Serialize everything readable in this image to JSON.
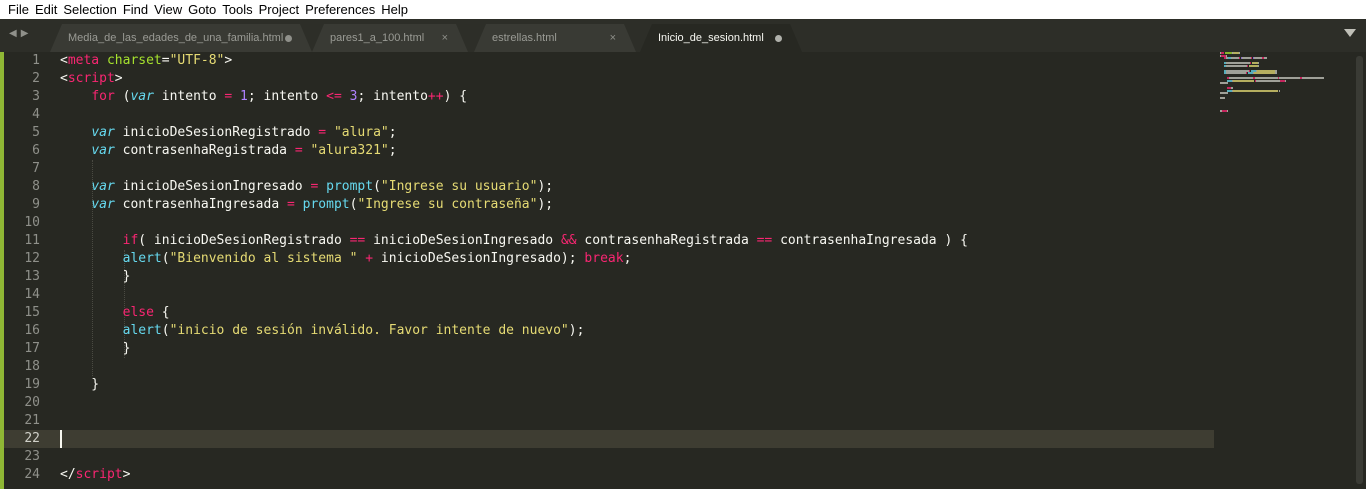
{
  "menu": [
    "File",
    "Edit",
    "Selection",
    "Find",
    "View",
    "Goto",
    "Tools",
    "Project",
    "Preferences",
    "Help"
  ],
  "tabs": [
    {
      "title": "Media_de_las_edades_de_una_familia.html",
      "indicator": "dot",
      "active": false
    },
    {
      "title": "pares1_a_100.html",
      "indicator": "close",
      "close_glyph": "×",
      "active": false
    },
    {
      "title": "estrellas.html",
      "indicator": "close",
      "close_glyph": "×",
      "active": false
    },
    {
      "title": "Inicio_de_sesion.html",
      "indicator": "dot",
      "active": true
    }
  ],
  "editor": {
    "current_line": 22,
    "line_numbers": [
      "1",
      "2",
      "3",
      "4",
      "5",
      "6",
      "7",
      "8",
      "9",
      "10",
      "11",
      "12",
      "13",
      "14",
      "15",
      "16",
      "17",
      "18",
      "19",
      "20",
      "21",
      "22",
      "23",
      "24"
    ],
    "lines": [
      [
        [
          "punct",
          "<"
        ],
        [
          "tag",
          "meta"
        ],
        [
          "punct",
          " "
        ],
        [
          "attr",
          "charset"
        ],
        [
          "punct",
          "="
        ],
        [
          "str",
          "\"UTF-8\""
        ],
        [
          "punct",
          ">"
        ]
      ],
      [
        [
          "punct",
          "<"
        ],
        [
          "tag",
          "script"
        ],
        [
          "punct",
          ">"
        ]
      ],
      [
        [
          "id",
          "    "
        ],
        [
          "kw",
          "for"
        ],
        [
          "id",
          " ("
        ],
        [
          "storage",
          "var"
        ],
        [
          "id",
          " intento "
        ],
        [
          "op",
          "="
        ],
        [
          "id",
          " "
        ],
        [
          "num",
          "1"
        ],
        [
          "id",
          "; intento "
        ],
        [
          "op",
          "<="
        ],
        [
          "id",
          " "
        ],
        [
          "num",
          "3"
        ],
        [
          "id",
          "; intento"
        ],
        [
          "op",
          "++"
        ],
        [
          "id",
          ") {"
        ]
      ],
      [],
      [
        [
          "id",
          "    "
        ],
        [
          "storage",
          "var"
        ],
        [
          "id",
          " inicioDeSesionRegistrado "
        ],
        [
          "op",
          "="
        ],
        [
          "id",
          " "
        ],
        [
          "str",
          "\"alura\""
        ],
        [
          "id",
          ";"
        ]
      ],
      [
        [
          "id",
          "    "
        ],
        [
          "storage",
          "var"
        ],
        [
          "id",
          " contrasenhaRegistrada "
        ],
        [
          "op",
          "="
        ],
        [
          "id",
          " "
        ],
        [
          "str",
          "\"alura321\""
        ],
        [
          "id",
          ";"
        ]
      ],
      [],
      [
        [
          "id",
          "    "
        ],
        [
          "storage",
          "var"
        ],
        [
          "id",
          " inicioDeSesionIngresado "
        ],
        [
          "op",
          "="
        ],
        [
          "id",
          " "
        ],
        [
          "fn",
          "prompt"
        ],
        [
          "id",
          "("
        ],
        [
          "str",
          "\"Ingrese su usuario\""
        ],
        [
          "id",
          ");"
        ]
      ],
      [
        [
          "id",
          "    "
        ],
        [
          "storage",
          "var"
        ],
        [
          "id",
          " contrasenhaIngresada "
        ],
        [
          "op",
          "="
        ],
        [
          "id",
          " "
        ],
        [
          "fn",
          "prompt"
        ],
        [
          "id",
          "("
        ],
        [
          "str",
          "\"Ingrese su contraseña\""
        ],
        [
          "id",
          ");"
        ]
      ],
      [],
      [
        [
          "id",
          "        "
        ],
        [
          "kw",
          "if"
        ],
        [
          "id",
          "( inicioDeSesionRegistrado "
        ],
        [
          "op",
          "=="
        ],
        [
          "id",
          " inicioDeSesionIngresado "
        ],
        [
          "op",
          "&&"
        ],
        [
          "id",
          " contrasenhaRegistrada "
        ],
        [
          "op",
          "=="
        ],
        [
          "id",
          " contrasenhaIngresada ) {"
        ]
      ],
      [
        [
          "id",
          "        "
        ],
        [
          "fn",
          "alert"
        ],
        [
          "id",
          "("
        ],
        [
          "str",
          "\"Bienvenido al sistema \""
        ],
        [
          "id",
          " "
        ],
        [
          "op",
          "+"
        ],
        [
          "id",
          " inicioDeSesionIngresado); "
        ],
        [
          "kw",
          "break"
        ],
        [
          "id",
          ";"
        ]
      ],
      [
        [
          "id",
          "        }"
        ]
      ],
      [],
      [
        [
          "id",
          "        "
        ],
        [
          "kw",
          "else"
        ],
        [
          "id",
          " {"
        ]
      ],
      [
        [
          "id",
          "        "
        ],
        [
          "fn",
          "alert"
        ],
        [
          "id",
          "("
        ],
        [
          "str",
          "\"inicio de sesión inválido. Favor intente de nuevo\""
        ],
        [
          "id",
          ");"
        ]
      ],
      [
        [
          "id",
          "        }"
        ]
      ],
      [],
      [
        [
          "id",
          "    }"
        ]
      ],
      [],
      [],
      [],
      [],
      [
        [
          "punct",
          "</"
        ],
        [
          "tag",
          "script"
        ],
        [
          "punct",
          ">"
        ]
      ]
    ]
  },
  "colors": {
    "background": "#272822",
    "modified_bar": "#8fb735",
    "keyword": "#f92672",
    "string": "#e6db74",
    "number": "#ae81ff",
    "function": "#66d9ef",
    "attribute": "#a6e22e"
  }
}
